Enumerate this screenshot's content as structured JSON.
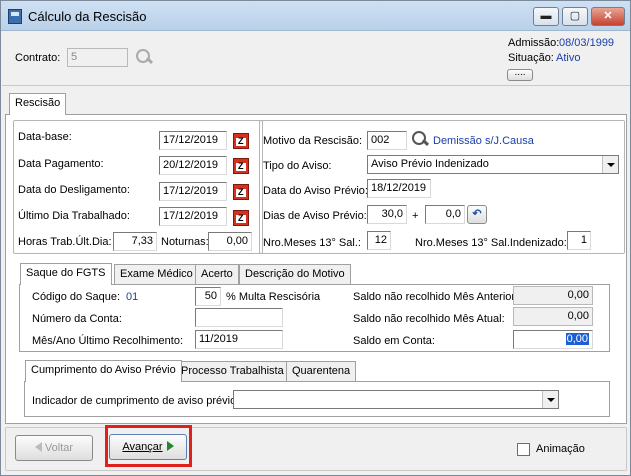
{
  "window": {
    "title": "Cálculo da Rescisão",
    "min_label": "▬",
    "max_label": "▢",
    "close_label": "✕"
  },
  "header": {
    "contrato_label": "Contrato:",
    "contrato_value": "5",
    "admissao_label": "Admissão:",
    "admissao_value": "08/03/1999",
    "situacao_label": "Situação:",
    "situacao_value": "Ativo",
    "more_label": "...."
  },
  "main_tab": "Rescisão",
  "left": {
    "data_base_label": "Data-base:",
    "data_base_value": "17/12/2019",
    "data_pagamento_label": "Data Pagamento:",
    "data_pagamento_value": "20/12/2019",
    "data_desligamento_label": "Data do Desligamento:",
    "data_desligamento_value": "17/12/2019",
    "ultimo_dia_label": "Último Dia Trabalhado:",
    "ultimo_dia_value": "17/12/2019",
    "horas_label": "Horas Trab.Últ.Dia:",
    "horas_value": "7,33",
    "noturnas_label": "Noturnas:",
    "noturnas_value": "0,00"
  },
  "right": {
    "motivo_label": "Motivo da Rescisão:",
    "motivo_code": "002",
    "motivo_desc": "Demissão s/J.Causa",
    "tipo_aviso_label": "Tipo do Aviso:",
    "tipo_aviso_value": "Aviso Prévio Indenizado",
    "data_aviso_label": "Data do Aviso Prévio:",
    "data_aviso_value": "18/12/2019",
    "dias_aviso_label": "Dias de Aviso Prévio:",
    "dias_aviso_value": "30,0",
    "plus": "+",
    "dias_extra_value": "0,0",
    "meses13_label": "Nro.Meses 13° Sal.:",
    "meses13_value": "12",
    "meses13_ind_label": "Nro.Meses 13° Sal.Indenizado:",
    "meses13_ind_value": "1"
  },
  "fgts_tabs": [
    "Saque do FGTS",
    "Exame Médico",
    "Acerto",
    "Descrição do Motivo"
  ],
  "fgts": {
    "codigo_label": "Código do Saque:",
    "codigo_value": "01",
    "multa_value": "50",
    "multa_label": "% Multa Rescisória",
    "conta_label": "Número da Conta:",
    "conta_value": "",
    "mes_ano_label": "Mês/Ano Último Recolhimento:",
    "mes_ano_value": "11/2019",
    "saldo_ant_label": "Saldo não recolhido Mês Anterior:",
    "saldo_ant_value": "0,00",
    "saldo_atual_label": "Saldo não recolhido Mês Atual:",
    "saldo_atual_value": "0,00",
    "saldo_conta_label": "Saldo em Conta:",
    "saldo_conta_value": "0,00"
  },
  "aviso_tabs": [
    "Cumprimento do Aviso Prévio",
    "Processo Trabalhista",
    "Quarentena"
  ],
  "aviso": {
    "indicador_label": "Indicador de cumprimento de aviso prévio:",
    "indicador_value": ""
  },
  "footer": {
    "voltar_label": "Voltar",
    "avancar_label": "Avançar",
    "animacao_label": "Animação",
    "highlight_color": "#e0201a"
  }
}
